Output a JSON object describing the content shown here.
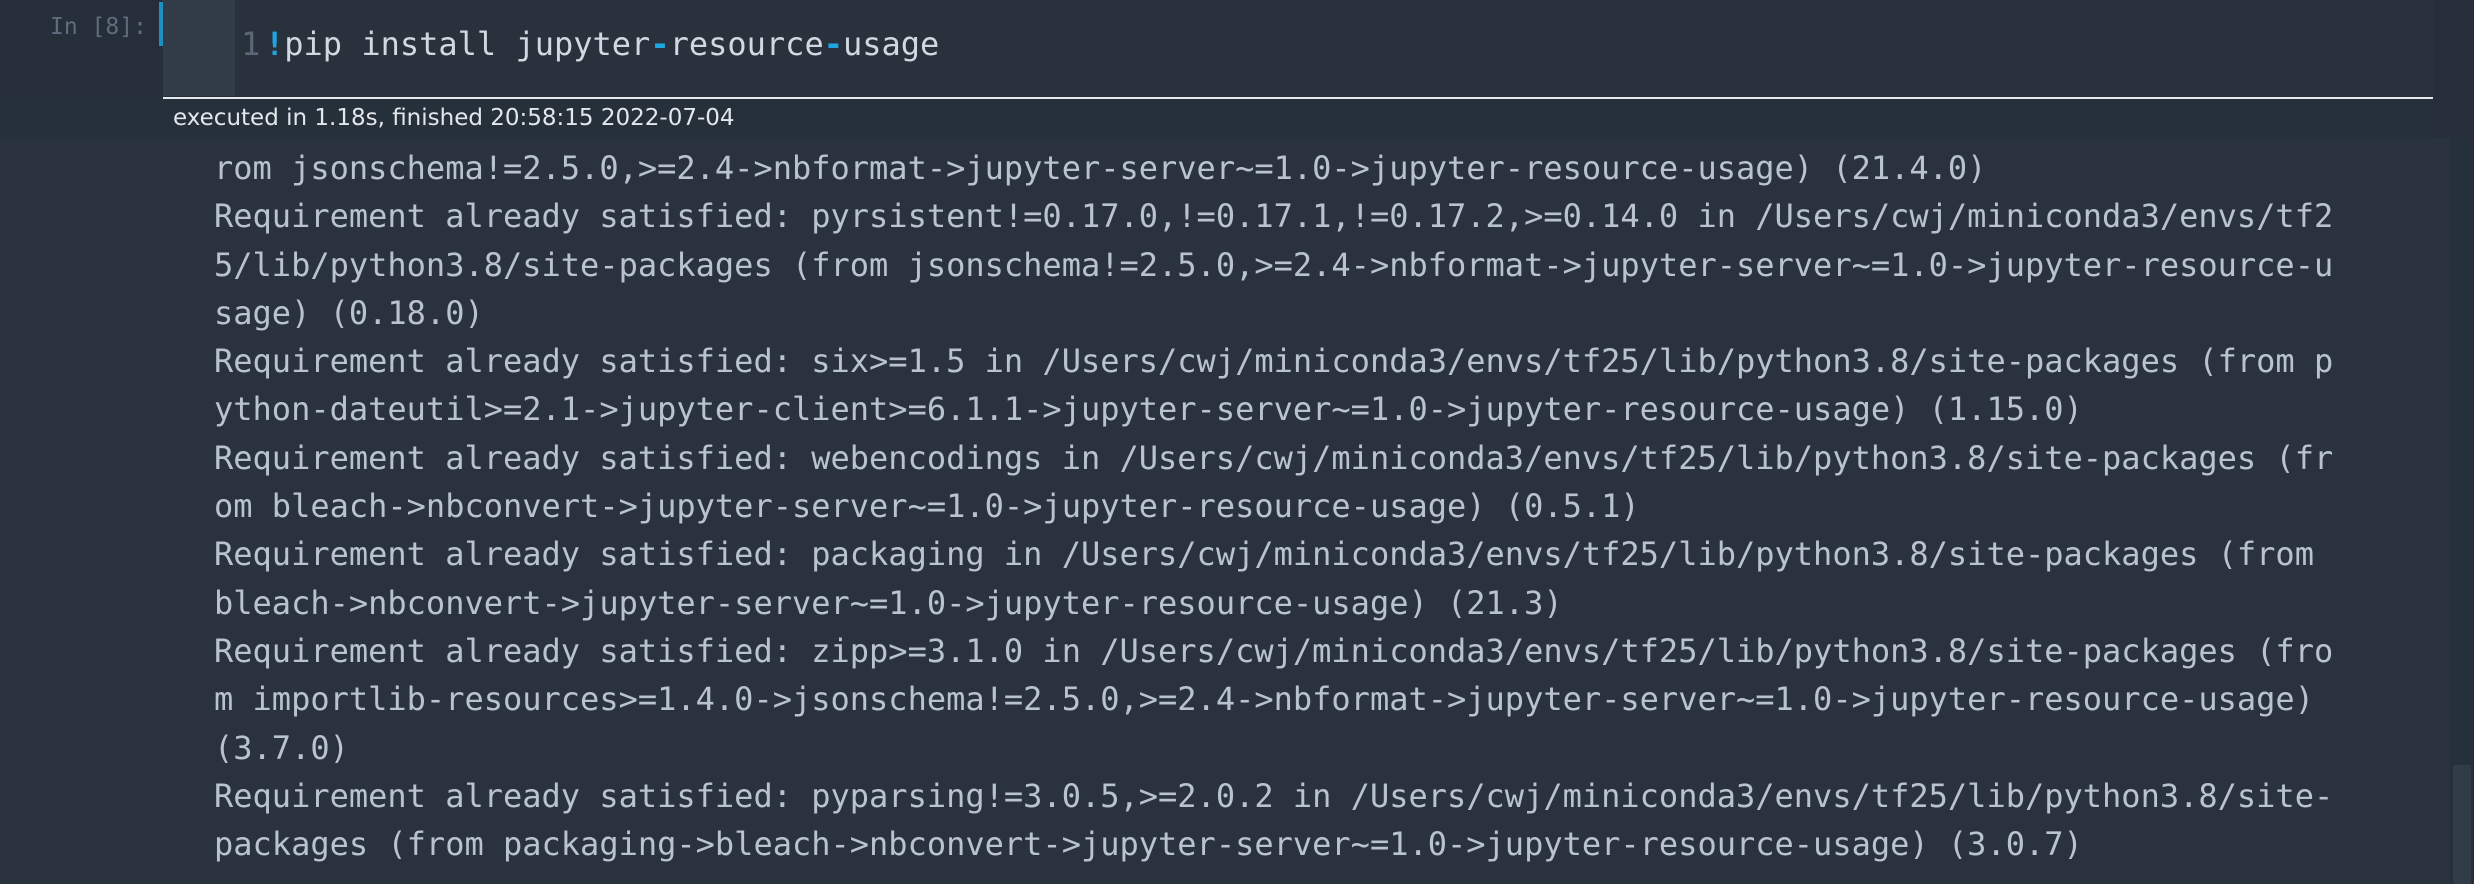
{
  "cell": {
    "prompt": "In [8]:",
    "line_number": "1",
    "code_bang": "!",
    "code_part1": "pip install jupyter",
    "code_dash1": "-",
    "code_part2": "resource",
    "code_dash2": "-",
    "code_part3": "usage",
    "exec_info": "executed in 1.18s, finished 20:58:15 2022-07-04"
  },
  "output_lines": [
    "rom jsonschema!=2.5.0,>=2.4->nbformat->jupyter-server~=1.0->jupyter-resource-usage) (21.4.0)",
    "Requirement already satisfied: pyrsistent!=0.17.0,!=0.17.1,!=0.17.2,>=0.14.0 in /Users/cwj/miniconda3/envs/tf2",
    "5/lib/python3.8/site-packages (from jsonschema!=2.5.0,>=2.4->nbformat->jupyter-server~=1.0->jupyter-resource-u",
    "sage) (0.18.0)",
    "Requirement already satisfied: six>=1.5 in /Users/cwj/miniconda3/envs/tf25/lib/python3.8/site-packages (from p",
    "ython-dateutil>=2.1->jupyter-client>=6.1.1->jupyter-server~=1.0->jupyter-resource-usage) (1.15.0)",
    "Requirement already satisfied: webencodings in /Users/cwj/miniconda3/envs/tf25/lib/python3.8/site-packages (fr",
    "om bleach->nbconvert->jupyter-server~=1.0->jupyter-resource-usage) (0.5.1)",
    "Requirement already satisfied: packaging in /Users/cwj/miniconda3/envs/tf25/lib/python3.8/site-packages (from",
    "bleach->nbconvert->jupyter-server~=1.0->jupyter-resource-usage) (21.3)",
    "Requirement already satisfied: zipp>=3.1.0 in /Users/cwj/miniconda3/envs/tf25/lib/python3.8/site-packages (fro",
    "m importlib-resources>=1.4.0->jsonschema!=2.5.0,>=2.4->nbformat->jupyter-server~=1.0->jupyter-resource-usage)",
    "(3.7.0)",
    "Requirement already satisfied: pyparsing!=3.0.5,>=2.0.2 in /Users/cwj/miniconda3/envs/tf25/lib/python3.8/site-",
    "packages (from packaging->bleach->nbconvert->jupyter-server~=1.0->jupyter-resource-usage) (3.0.7)"
  ],
  "colors": {
    "background": "#26303b",
    "accent": "#1fa6e0",
    "output_text": "#b9c3cf",
    "code_text": "#d2d8df"
  }
}
